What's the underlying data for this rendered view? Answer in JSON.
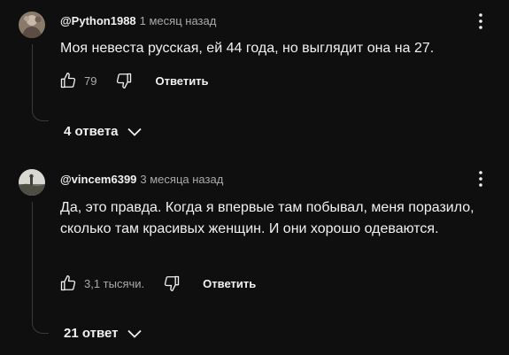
{
  "comments": [
    {
      "author": "@Python1988",
      "time": "1 месяц назад",
      "text": "Моя невеста русская, ей 44 года, но выглядит она на 27.",
      "likes": "79",
      "reply_label": "Ответить",
      "replies_label": "4 ответа"
    },
    {
      "author": "@vincem6399",
      "time": "3 месяца назад",
      "text": "Да, это правда. Когда я впервые там побывал, меня поразило, сколько там красивых женщин. И они хорошо одеваются.",
      "likes": "3,1 тысячи.",
      "reply_label": "Ответить",
      "replies_label": "21 ответ"
    }
  ],
  "icons": {
    "like": "thumb-up-icon",
    "dislike": "thumb-down-icon",
    "more": "more-vertical-icon",
    "expand": "chevron-down-icon"
  },
  "colors": {
    "background": "#0f0f0f",
    "text": "#f1f1f1",
    "secondary": "#aaaaaa"
  }
}
